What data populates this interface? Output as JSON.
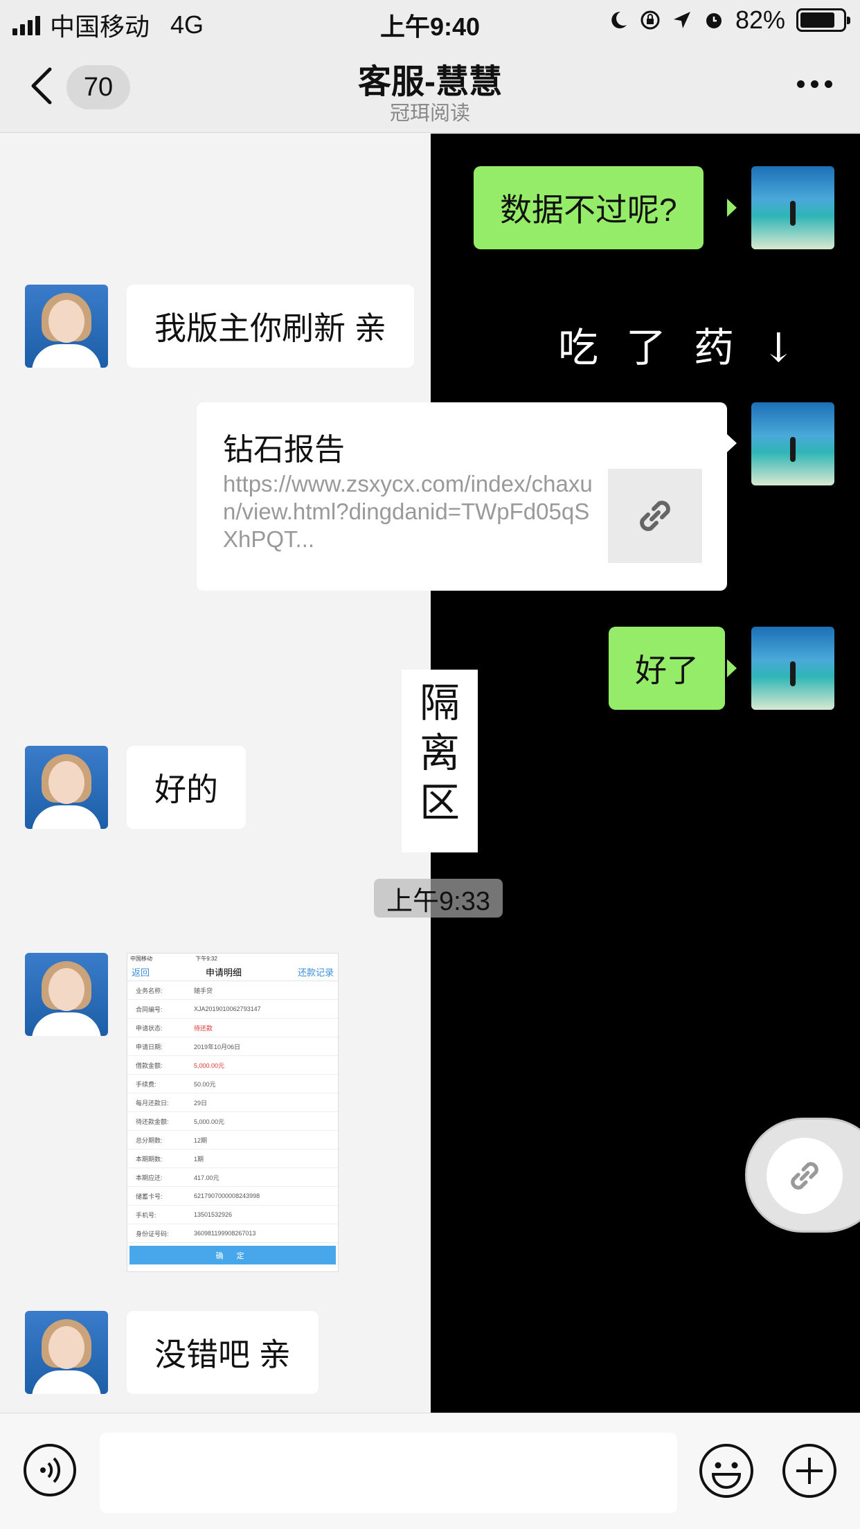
{
  "status": {
    "carrier": "中国移动",
    "network": "4G",
    "time": "上午9:40",
    "battery": "82%"
  },
  "nav": {
    "badge": "70",
    "title": "客服-慧慧",
    "subtitle": "冠珥阅读"
  },
  "messages": {
    "m1": "数据不过呢?",
    "m2": "我版主你刷新  亲",
    "sticker": "吃了药↓",
    "link": {
      "title": "钻石报告",
      "url": "https://www.zsxycx.com/index/chaxun/view.html?dingdanid=TWpFd05qSXhPQT..."
    },
    "m3": "好了",
    "stamp": "隔离区",
    "m4": "好的",
    "time": "上午9:33",
    "m5": "没错吧  亲"
  },
  "screenshot": {
    "status_left": "中国移动",
    "status_time": "下午9:32",
    "back": "返回",
    "title": "申请明细",
    "record": "还款记录",
    "rows": [
      {
        "k": "业务名称:",
        "v": "随手贷"
      },
      {
        "k": "合同编号:",
        "v": "XJA2019010062793147"
      },
      {
        "k": "申请状态:",
        "v": "待还款"
      },
      {
        "k": "申请日期:",
        "v": "2019年10月06日"
      },
      {
        "k": "借款金额:",
        "v": "5,000.00元"
      },
      {
        "k": "手续费:",
        "v": "50.00元"
      },
      {
        "k": "每月还款日:",
        "v": "29日"
      },
      {
        "k": "待还款金额:",
        "v": "5,000.00元"
      },
      {
        "k": "总分期数:",
        "v": "12期"
      },
      {
        "k": "本期期数:",
        "v": "1期"
      },
      {
        "k": "本期应还:",
        "v": "417.00元"
      },
      {
        "k": "储蓄卡号:",
        "v": "6217907000008243998"
      },
      {
        "k": "手机号:",
        "v": "13501532926"
      },
      {
        "k": "身份证号码:",
        "v": "360981199908267013"
      }
    ],
    "confirm": "确 定"
  },
  "input": {
    "placeholder": ""
  }
}
